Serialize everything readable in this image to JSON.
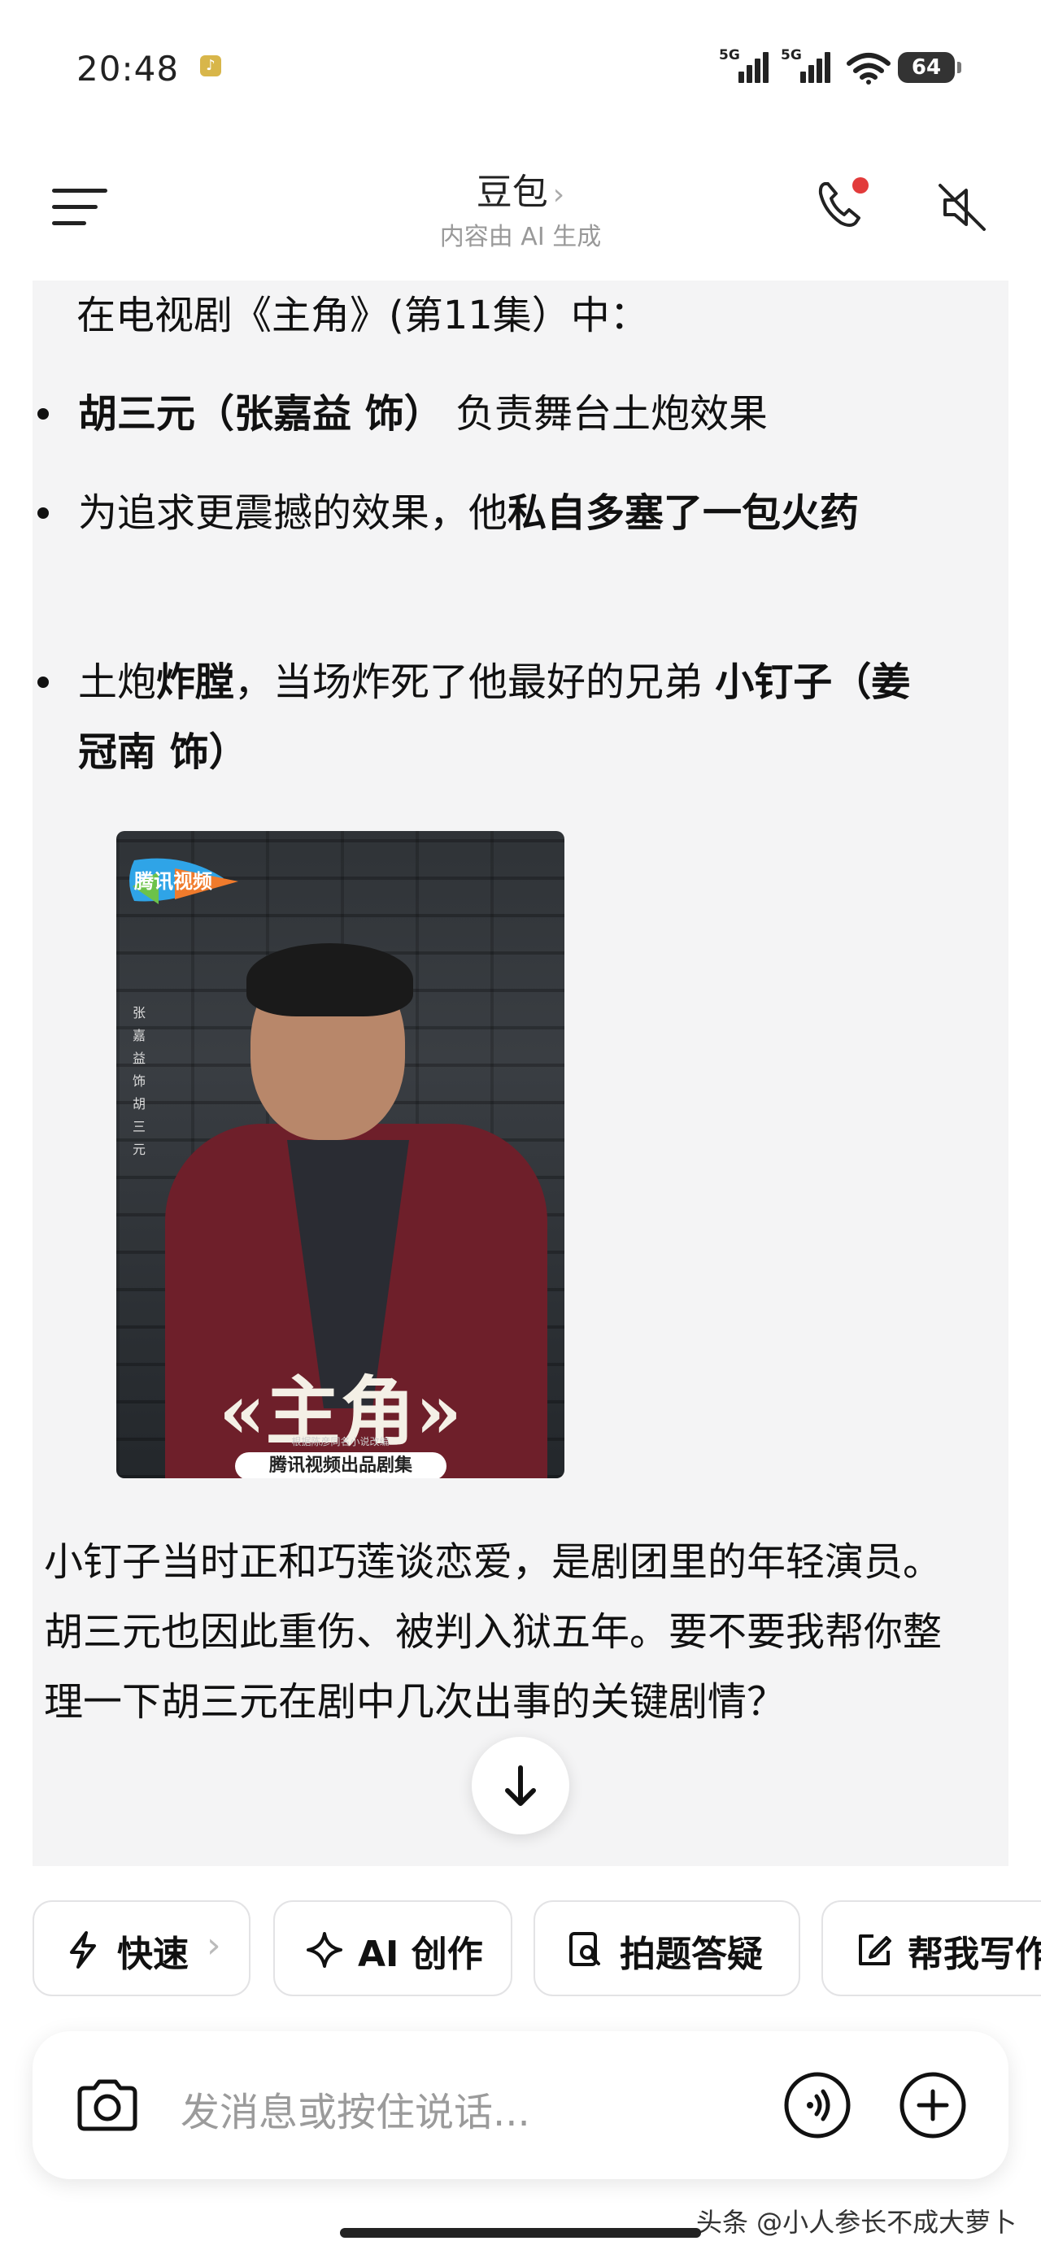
{
  "status_bar": {
    "time": "20:48",
    "network1": "5G",
    "network2": "5G",
    "battery": "64"
  },
  "nav": {
    "title": "豆包",
    "chevron": "›",
    "subtitle": "内容由 AI 生成"
  },
  "message": {
    "intro": "在电视剧《主角》(第11集）中：",
    "bullets": [
      {
        "bold": "胡三元（张嘉益 饰）",
        "text": "负责舞台土炮效果"
      },
      {
        "pre": "为追求更震撼的效果，他",
        "bold": "私自多塞了一包火药"
      },
      {
        "pre": "土炮",
        "bold1": "炸膛",
        "mid": "，当场炸死了他最好的兄弟 ",
        "bold2": "小钉子（姜冠南 饰）"
      }
    ],
    "followup": "小钉子当时正和巧莲谈恋爱，是剧团里的年轻演员。胡三元也因此重伤、被判入狱五年。要不要我帮你整理一下胡三元在剧中几次出事的关键剧情？"
  },
  "poster": {
    "logo": "腾讯视频",
    "vertical_caption": "张嘉益 饰 胡三元",
    "title": "«主角»",
    "small_line": "根据陈彦同名小说改编",
    "badge": "腾讯视频出品剧集"
  },
  "chips": [
    {
      "label": "快速",
      "icon": "lightning-icon",
      "has_chevron": true
    },
    {
      "label": "AI 创作",
      "icon": "sparkle-icon"
    },
    {
      "label": "拍题答疑",
      "icon": "doc-search-icon"
    },
    {
      "label": "帮我写作",
      "icon": "edit-icon"
    }
  ],
  "input": {
    "placeholder": "发消息或按住说话..."
  },
  "watermark": "头条 @小人参长不成大萝卜",
  "colors": {
    "bubble_bg": "#f4f4f5",
    "notify_dot": "#e23b3b"
  }
}
